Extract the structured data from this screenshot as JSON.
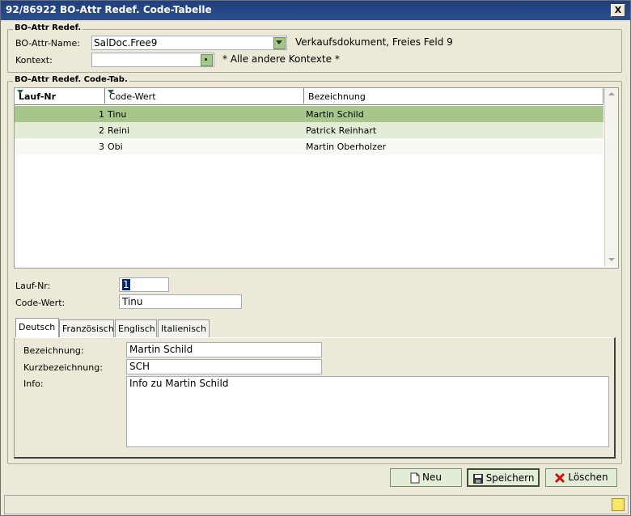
{
  "window": {
    "title": "92/86922 BO-Attr Redef. Code-Tabelle",
    "close_label": "X"
  },
  "redef_group": {
    "label": "BO-Attr Redef.",
    "attr_name_label": "BO-Attr-Name:",
    "attr_name_value": "SalDoc.Free9",
    "attr_name_desc": "Verkaufsdokument, Freies Feld 9",
    "context_label": "Kontext:",
    "context_value": "",
    "context_desc": "* Alle andere Kontexte *"
  },
  "table_group": {
    "label": "BO-Attr Redef. Code-Tab.",
    "columns": [
      "Lauf-Nr",
      "Code-Wert",
      "Bezeichnung"
    ],
    "rows": [
      {
        "nr": "1",
        "code": "Tinu",
        "bez": "Martin Schild"
      },
      {
        "nr": "2",
        "code": "Reini",
        "bez": "Patrick Reinhart"
      },
      {
        "nr": "3",
        "code": "Obi",
        "bez": "Martin Oberholzer"
      }
    ]
  },
  "detail": {
    "lauf_nr_label": "Lauf-Nr:",
    "lauf_nr_value": "1",
    "code_wert_label": "Code-Wert:",
    "code_wert_value": "Tinu"
  },
  "tabs": [
    "Deutsch",
    "Französisch",
    "Englisch",
    "Italienisch"
  ],
  "tab_de": {
    "bez_label": "Bezeichnung:",
    "bez_value": "Martin Schild",
    "kurz_label": "Kurzbezeichnung:",
    "kurz_value": "SCH",
    "info_label": "Info:",
    "info_value": "Info zu Martin Schild"
  },
  "buttons": {
    "new": "Neu",
    "save": "Speichern",
    "delete": "Löschen"
  },
  "colors": {
    "selected_row": "#a6c68c",
    "alt_row": "#e3ecd6",
    "title_bar": "#2d4f8e"
  }
}
